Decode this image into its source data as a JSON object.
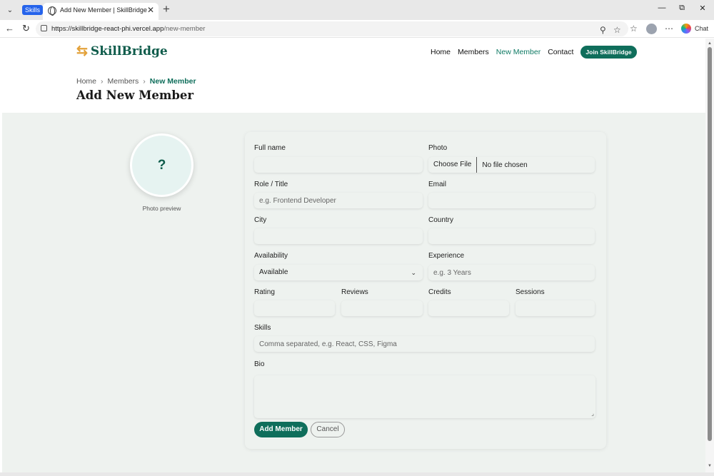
{
  "browser": {
    "tab_group_label": "Skills",
    "tab_title": "Add New Member | SkillBridge",
    "url_host": "https://skillbridge-react-phi.vercel.app",
    "url_path": "/new-member",
    "chat_label": "Chat"
  },
  "header": {
    "logo_text": "SkillBridge",
    "nav": [
      "Home",
      "Members",
      "New Member",
      "Contact"
    ],
    "join_label": "Join SkillBridge"
  },
  "breadcrumb": [
    "Home",
    "Members",
    "New Member"
  ],
  "page_title": "Add New Member",
  "photo_preview": {
    "placeholder": "?",
    "caption": "Photo preview"
  },
  "form": {
    "full_name": {
      "label": "Full name",
      "placeholder": ""
    },
    "photo": {
      "label": "Photo",
      "button": "Choose File",
      "status": "No file chosen"
    },
    "role": {
      "label": "Role / Title",
      "placeholder": "e.g. Frontend Developer"
    },
    "email": {
      "label": "Email",
      "placeholder": ""
    },
    "city": {
      "label": "City",
      "placeholder": ""
    },
    "country": {
      "label": "Country",
      "placeholder": ""
    },
    "availability": {
      "label": "Availability",
      "value": "Available"
    },
    "experience": {
      "label": "Experience",
      "placeholder": "e.g. 3 Years"
    },
    "rating": {
      "label": "Rating"
    },
    "reviews": {
      "label": "Reviews"
    },
    "credits": {
      "label": "Credits"
    },
    "sessions": {
      "label": "Sessions"
    },
    "skills": {
      "label": "Skills",
      "placeholder": "Comma separated, e.g. React, CSS, Figma"
    },
    "bio": {
      "label": "Bio"
    },
    "submit_label": "Add Member",
    "cancel_label": "Cancel"
  }
}
